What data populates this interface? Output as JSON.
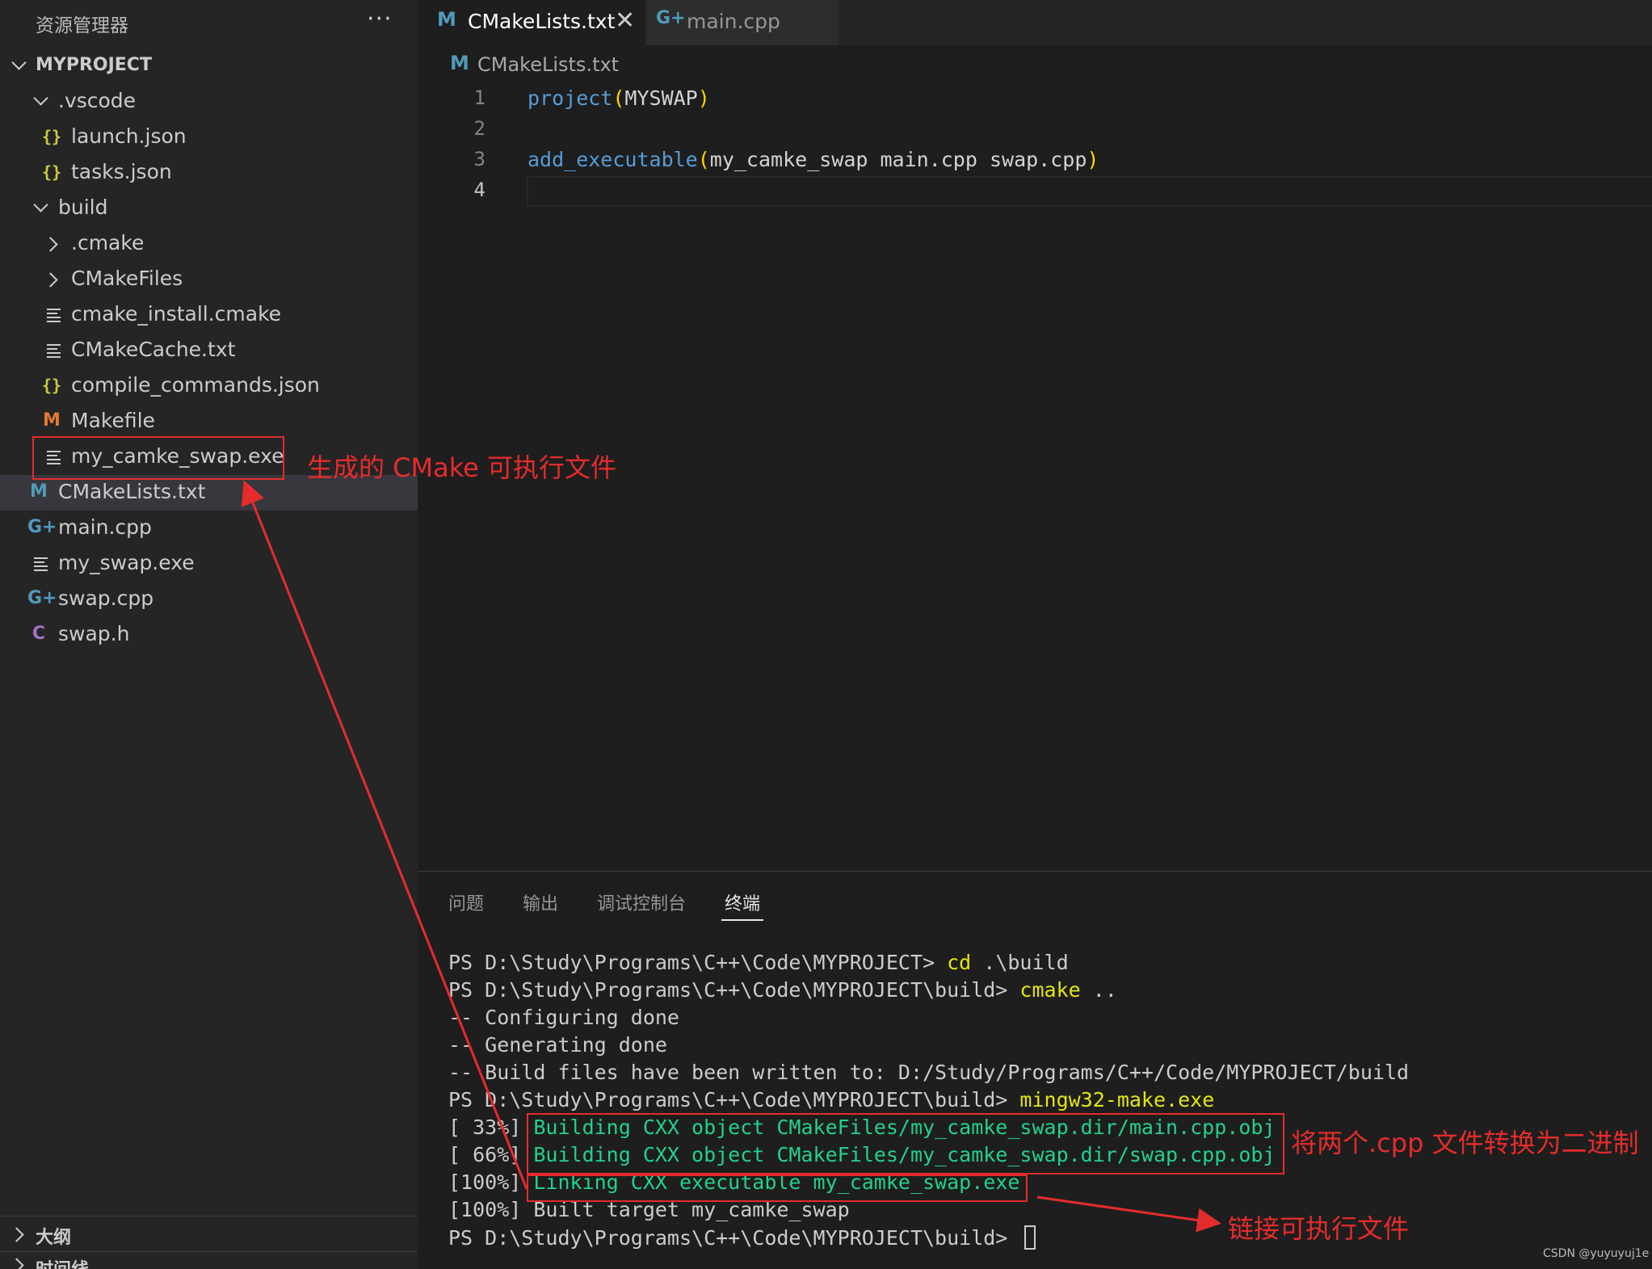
{
  "sidebar": {
    "title": "资源管理器",
    "more_label": "···",
    "project": "MYPROJECT",
    "items": [
      {
        "label": ".vscode"
      },
      {
        "label": "launch.json",
        "icon": "{}"
      },
      {
        "label": "tasks.json",
        "icon": "{}"
      },
      {
        "label": "build"
      },
      {
        "label": ".cmake"
      },
      {
        "label": "CMakeFiles"
      },
      {
        "label": "cmake_install.cmake"
      },
      {
        "label": "CMakeCache.txt"
      },
      {
        "label": "compile_commands.json",
        "icon": "{}"
      },
      {
        "label": "Makefile",
        "icon": "M"
      },
      {
        "label": "my_camke_swap.exe"
      },
      {
        "label": "CMakeLists.txt",
        "icon": "M"
      },
      {
        "label": "main.cpp",
        "icon": "G+"
      },
      {
        "label": "my_swap.exe"
      },
      {
        "label": "swap.cpp",
        "icon": "G+"
      },
      {
        "label": "swap.h",
        "icon": "C"
      }
    ],
    "outline_label": "大纲",
    "timeline_label": "时间线"
  },
  "tabs": [
    {
      "label": "CMakeLists.txt",
      "icon": "M",
      "close": "✕",
      "active": true
    },
    {
      "label": "main.cpp",
      "icon": "G+",
      "active": false
    }
  ],
  "breadcrumb": {
    "icon": "M",
    "label": "CMakeLists.txt"
  },
  "editor": {
    "line_numbers": [
      "1",
      "2",
      "3",
      "4"
    ],
    "lines": [
      {
        "fn": "project",
        "open": "(",
        "args": "MYSWAP",
        "close": ")"
      },
      {
        "fn": "",
        "open": "",
        "args": "",
        "close": ""
      },
      {
        "fn": "add_executable",
        "open": "(",
        "args": "my_camke_swap main.cpp swap.cpp",
        "close": ")"
      },
      {
        "fn": "",
        "open": "",
        "args": "",
        "close": ""
      }
    ]
  },
  "panel": {
    "tabs": [
      "问题",
      "输出",
      "调试控制台",
      "终端"
    ],
    "active_tab": "终端",
    "terminal": [
      {
        "prefix": "PS D:\\Study\\Programs\\C++\\Code\\MYPROJECT> ",
        "cmd": "cd",
        "rest": " .\\build"
      },
      {
        "prefix": "PS D:\\Study\\Programs\\C++\\Code\\MYPROJECT\\build> ",
        "cmd": "cmake",
        "rest": " .."
      },
      {
        "prefix": "-- Configuring done",
        "cmd": "",
        "rest": ""
      },
      {
        "prefix": "-- Generating done",
        "cmd": "",
        "rest": ""
      },
      {
        "prefix": "-- Build files have been written to: D:/Study/Programs/C++/Code/MYPROJECT/build",
        "cmd": "",
        "rest": ""
      },
      {
        "prefix": "PS D:\\Study\\Programs\\C++\\Code\\MYPROJECT\\build> ",
        "cmd": "mingw32-make.exe",
        "rest": ""
      },
      {
        "prefix": "[ 33%] ",
        "green": "Building CXX object CMakeFiles/my_camke_swap.dir/main.cpp.obj"
      },
      {
        "prefix": "[ 66%] ",
        "green": "Building CXX object CMakeFiles/my_camke_swap.dir/swap.cpp.obj"
      },
      {
        "prefix": "[100%] ",
        "green": "Linking CXX executable my_camke_swap.exe"
      },
      {
        "prefix": "[100%] Built target my_camke_swap",
        "cmd": "",
        "rest": ""
      },
      {
        "prefix": "PS D:\\Study\\Programs\\C++\\Code\\MYPROJECT\\build> ",
        "cmd": "",
        "rest": ""
      }
    ]
  },
  "annotations": {
    "exe_note": "生成的 CMake 可执行文件",
    "compile_note": "将两个.cpp 文件转换为二进制",
    "link_note": "链接可执行文件",
    "color": "#e52c2c"
  },
  "watermark": "CSDN @yuyuyuj1e",
  "colors": {
    "sidebar_bg": "#252526",
    "editor_bg": "#1e1e1e",
    "keyword": "#569cd6",
    "bracket": "#ffd700",
    "terminal_green": "#23d18b",
    "terminal_yellow": "#e5e510"
  }
}
